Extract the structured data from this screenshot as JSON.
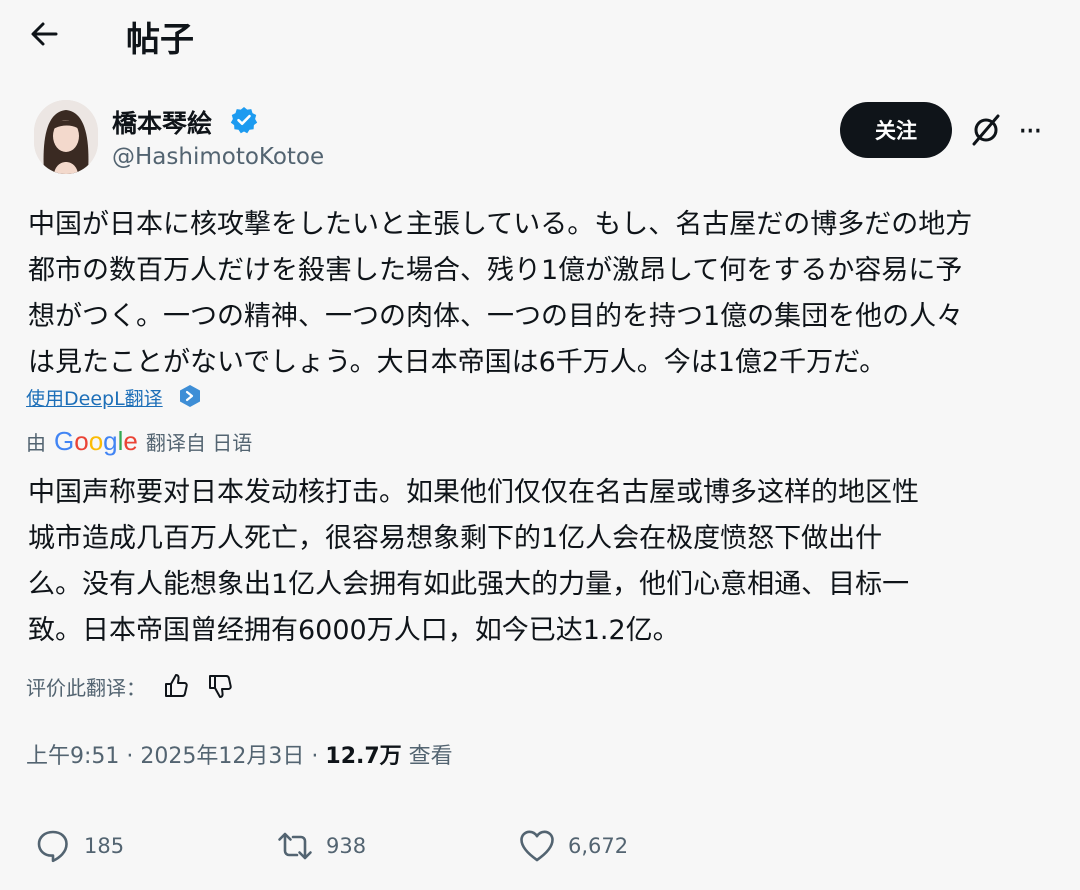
{
  "header": {
    "title": "帖子"
  },
  "author": {
    "name": "橋本琴絵",
    "handle": "@HashimotoKotoe"
  },
  "follow_label": "关注",
  "post": {
    "original_lines": [
      "中国が日本に核攻撃をしたいと主張している。もし、名古屋だの博多だの地方",
      "都市の数百万人だけを殺害した場合、残り1億が激昂して何をするか容易に予",
      "想がつく。一つの精神、一つの肉体、一つの目的を持つ1億の集団を他の人々",
      "は見たことがないでしょう。大日本帝国は6千万人。今は1億2千万だ。"
    ],
    "deepl_link": "使用DeepL翻译",
    "translated_by_prefix": "由",
    "translated_by_brand": "Google",
    "translated_from": "翻译自 日语",
    "translation_lines": [
      "中国声称要对日本发动核打击。如果他们仅仅在名古屋或博多这样的地区性",
      "城市造成几百万人死亡，很容易想象剩下的1亿人会在极度愤怒下做出什",
      "么。没有人能想象出1亿人会拥有如此强大的力量，他们心意相通、目标一",
      "致。日本帝国曾经拥有6000万人口，如今已达1.2亿。"
    ],
    "rate_label": "评价此翻译：",
    "time": "上午9:51",
    "date": "2025年12月3日",
    "sep": "·",
    "views_count": "12.7万",
    "views_label": "查看"
  },
  "stats": {
    "replies": "185",
    "reposts": "938",
    "likes": "6,672"
  },
  "colors": {
    "accent_blue": "#1d9bf0",
    "text": "#0f1419",
    "muted": "#536471",
    "google": [
      "#4285F4",
      "#EA4335",
      "#FBBC05",
      "#34A853"
    ]
  }
}
